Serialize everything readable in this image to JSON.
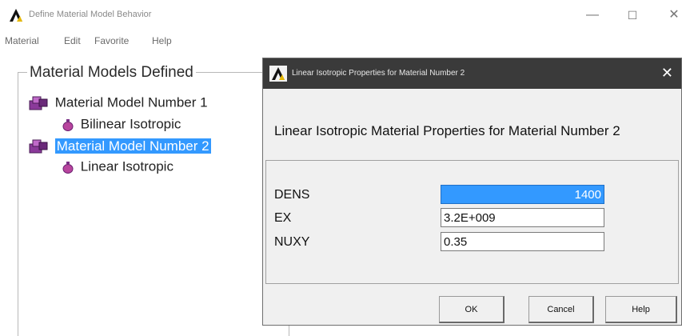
{
  "main_window": {
    "title": "Define Material Model Behavior",
    "controls": {
      "minimize": "—",
      "maximize": "☐",
      "close": "✕"
    },
    "menu": [
      "Material",
      "Edit",
      "Favorite",
      "Help"
    ]
  },
  "tree": {
    "group_title": "Material Models Defined",
    "items": [
      {
        "label": "Material Model Number 1",
        "level": 0,
        "selected": false
      },
      {
        "label": "Bilinear Isotropic",
        "level": 1,
        "selected": false
      },
      {
        "label": "Material Model Number 2",
        "level": 0,
        "selected": true
      },
      {
        "label": "Linear Isotropic",
        "level": 1,
        "selected": false
      }
    ]
  },
  "dialog": {
    "title": "Linear Isotropic Properties for Material Number 2",
    "close": "✕",
    "heading": "Linear Isotropic Material Properties for Material Number 2",
    "properties": [
      {
        "label": "DENS",
        "value": "1400"
      },
      {
        "label": "EX",
        "value": "3.2E+009"
      },
      {
        "label": "NUXY",
        "value": "0.35"
      }
    ],
    "buttons": {
      "ok": "OK",
      "cancel": "Cancel",
      "help": "Help"
    }
  },
  "colors": {
    "selection": "#3399ff",
    "dialog_titlebar": "#3a3a3a",
    "dialog_body": "#f0f0f0",
    "folder_icon": "#8b3a9a",
    "leaf_icon": "#b8459e"
  }
}
